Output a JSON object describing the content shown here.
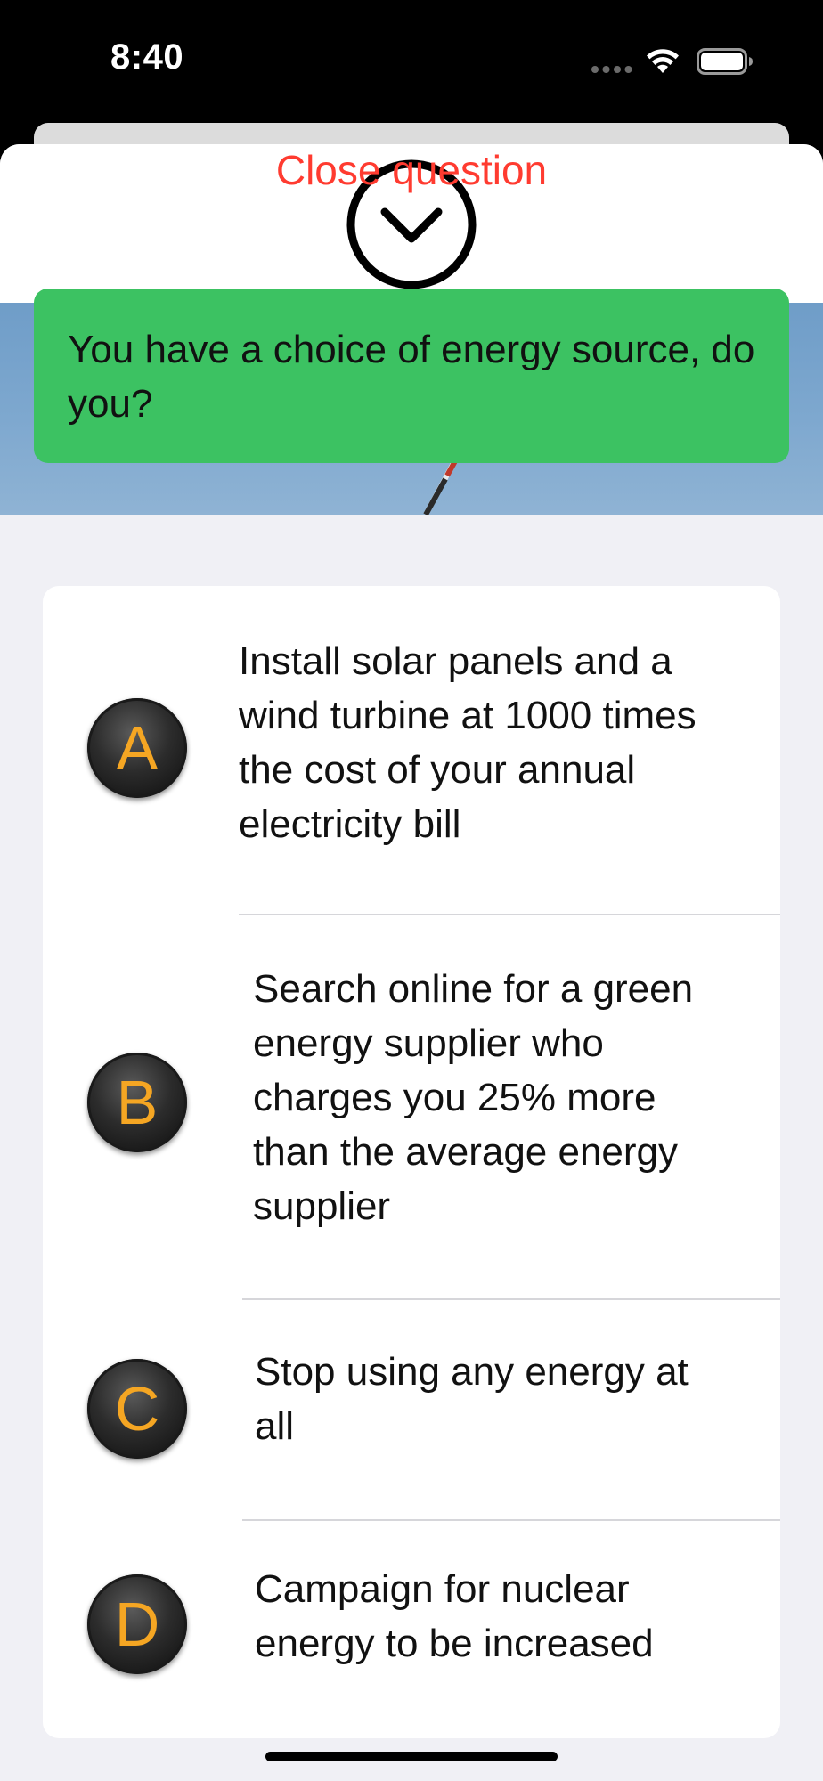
{
  "status_bar": {
    "time": "8:40"
  },
  "sheet": {
    "close_label": "Close question",
    "close_icon": "chevron-down-circle-icon"
  },
  "question": {
    "text": "You have a choice of energy source, do you?"
  },
  "answers": [
    {
      "letter": "A",
      "text": "Install solar panels and a wind turbine at 1000 times the cost of your annual electricity bill"
    },
    {
      "letter": "B",
      "text": "Search online for a green energy supplier who charges you 25% more than the average energy supplier"
    },
    {
      "letter": "C",
      "text": "Stop using any energy at all"
    },
    {
      "letter": "D",
      "text": "Campaign for nuclear energy to be increased"
    }
  ],
  "colors": {
    "close_label": "#ff3b30",
    "question_banner": "#3cc262",
    "badge_letter": "#f5a623",
    "background": "#f0f0f5"
  }
}
